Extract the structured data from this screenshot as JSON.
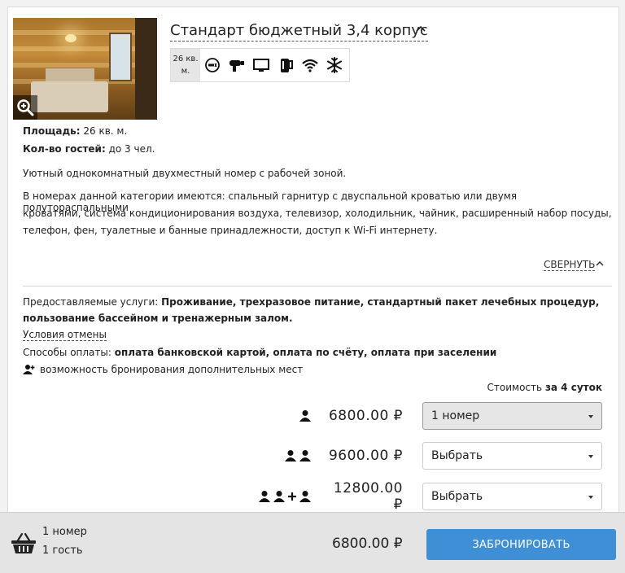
{
  "room": {
    "title": "Стандарт бюджетный 3,4 корпус",
    "area_badge_line1": "26 кв.",
    "area_badge_line2": "м.",
    "amenities": [
      "no-smoking-icon",
      "hairdryer-icon",
      "tv-icon",
      "kettle-icon",
      "wifi-icon",
      "air-conditioning-icon"
    ],
    "area_label": "Площадь:",
    "area_value": "26 кв. м.",
    "guests_label": "Кол-во гостей:",
    "guests_value": "до 3 чел.",
    "description_short": "Уютный однокомнатный двухместный номер с рабочей зоной.",
    "description_line1": "В номерах данной категории имеются: спальный гарнитур с двуспальной кроватью или двумя полутораспальными",
    "description_line2": "кроватями, система кондиционирования воздуха, телевизор, холодильник, чайник, расширенный набор посуды,",
    "description_line3": "телефон, фен, туалетные и банные принадлежности, доступ к Wi-Fi интернету.",
    "collapse_label": "СВЕРНУТЬ"
  },
  "services": {
    "label": "Предоставляемые услуги:",
    "value_line1": "Проживание, трехразовое питание, стандартный пакет лечебных процедур,",
    "value_line2": "пользование бассейном и тренажерным залом.",
    "cancel_link": "Условия отмены",
    "payment_label": "Способы оплаты:",
    "payment_value": "оплата банковской картой, оплата по счёту, оплата при заселении",
    "extra_beds": "возможность бронирования дополнительных мест"
  },
  "pricing": {
    "cost_label": "Стоимость",
    "cost_period": "за 4 суток",
    "rows": [
      {
        "persons": "1",
        "price": "6800.00 ₽",
        "select": "1 номер"
      },
      {
        "persons": "2",
        "price": "9600.00 ₽",
        "select": "Выбрать"
      },
      {
        "persons": "2+1",
        "price": "12800.00 ₽",
        "select": "Выбрать"
      }
    ]
  },
  "footer": {
    "rooms": "1 номер",
    "guests": "1 гость",
    "total": "6800.00 ₽",
    "book_label": "ЗАБРОНИРОВАТЬ"
  },
  "colors": {
    "accent": "#3e8fd6",
    "footer_bg": "#e4e4e4",
    "selected_bg": "#e6e6e6"
  }
}
